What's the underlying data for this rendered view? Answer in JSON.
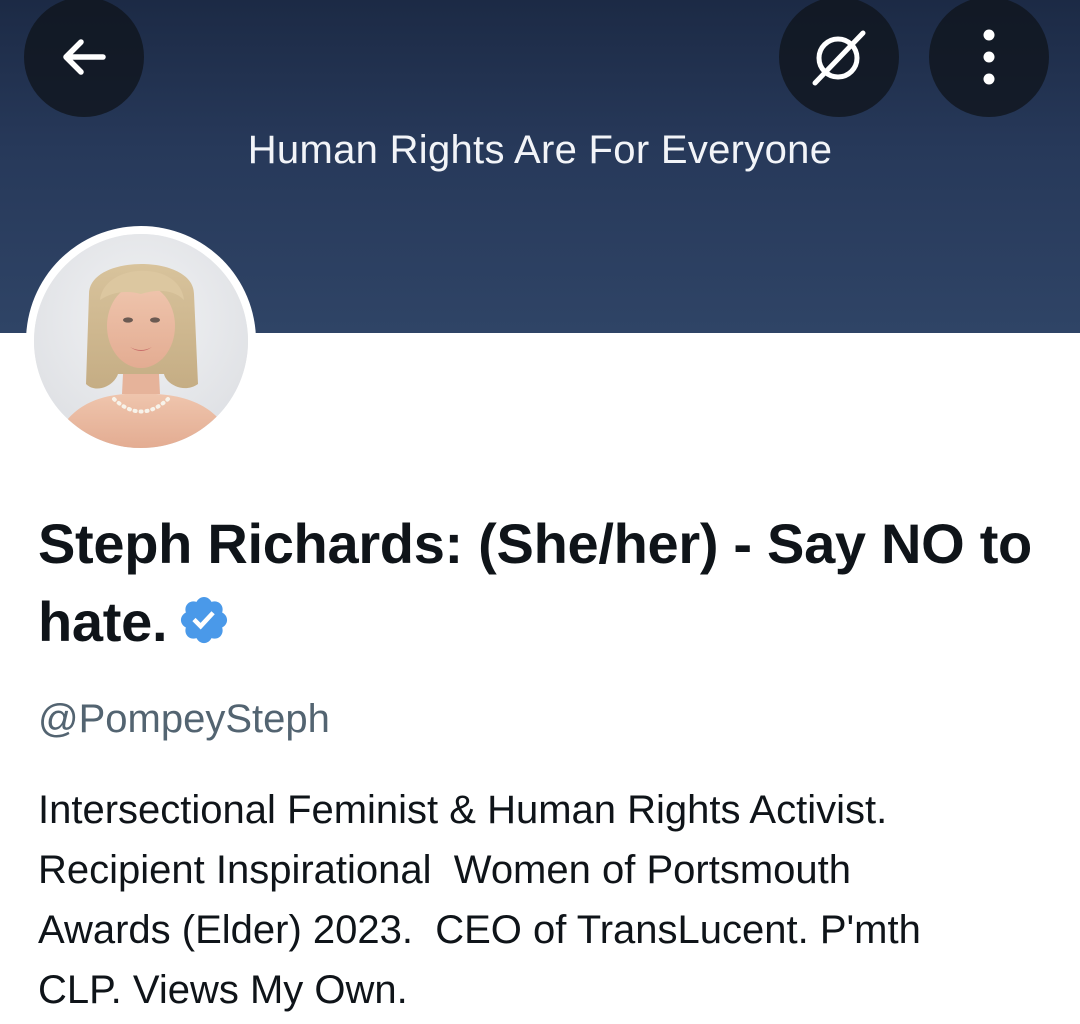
{
  "header": {
    "banner_text": "Human Rights Are For Everyone",
    "banner_color": "#27395a",
    "back_icon": "arrow-left-icon",
    "grok_icon": "grok-icon",
    "more_icon": "more-vertical-icon"
  },
  "profile": {
    "display_name": "Steph Richards: (She/her) - Say NO to hate.",
    "verified_badge": "verified-badge-icon",
    "verified_color": "#4a99e9",
    "handle": "@PompeySteph",
    "bio": "Intersectional Feminist & Human Rights Activist.\nRecipient Inspirational  Women of Portsmouth\nAwards (Elder) 2023.  CEO of TransLucent. P'mth\nCLP. Views My Own."
  }
}
